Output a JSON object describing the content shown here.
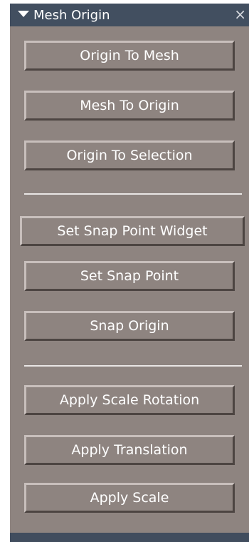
{
  "panel": {
    "title": "Mesh Origin",
    "close_glyph": "×",
    "collapse_icon": "triangle-down-icon"
  },
  "groups": [
    {
      "buttons": [
        {
          "label": "Origin To Mesh"
        },
        {
          "label": "Mesh To Origin"
        },
        {
          "label": "Origin To Selection"
        }
      ]
    },
    {
      "buttons": [
        {
          "label": "Set Snap Point Widget"
        },
        {
          "label": "Set Snap Point"
        },
        {
          "label": "Snap Origin"
        }
      ]
    },
    {
      "buttons": [
        {
          "label": "Apply Scale Rotation"
        },
        {
          "label": "Apply Translation"
        },
        {
          "label": "Apply Scale"
        }
      ]
    }
  ],
  "colors": {
    "titlebar": "#424f60",
    "panel_bg": "#8e8480",
    "button_text": "#ffffff",
    "divider": "#e9e6e5"
  }
}
